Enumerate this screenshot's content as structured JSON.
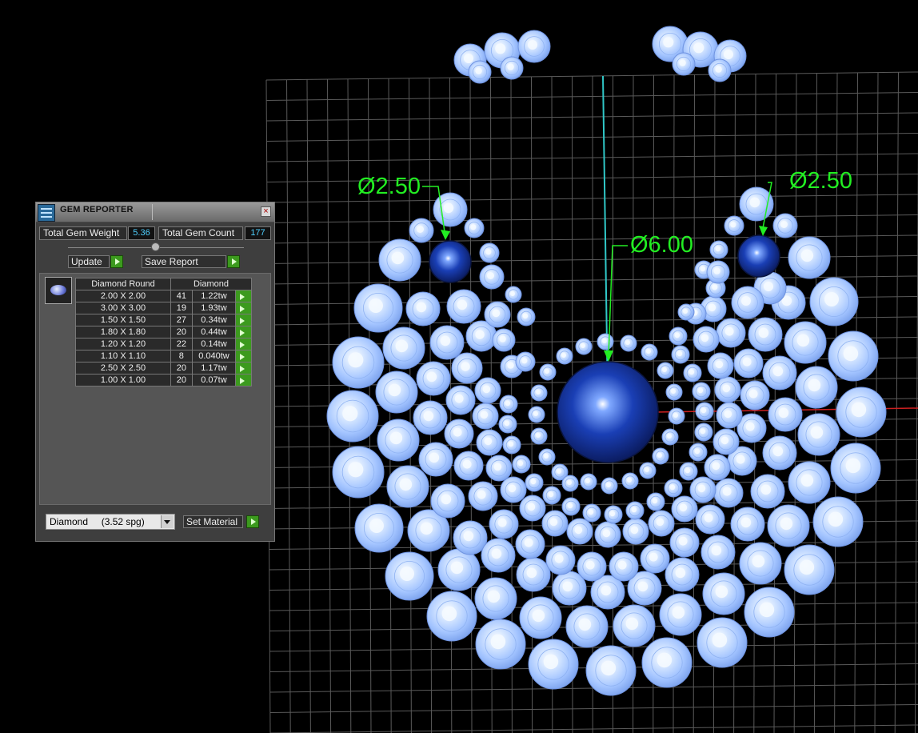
{
  "viewport": {
    "dim_labels": [
      "Ø2.50",
      "Ø6.00",
      "Ø2.50"
    ],
    "colors": {
      "background": "#000000",
      "grid": "#5a5a5a",
      "gem": "#a9c9ff",
      "center_stone": "#1a3fb5",
      "dimension": "#22ee22",
      "axis_y": "#30c8c8",
      "axis_x": "#cc2020"
    }
  },
  "panel": {
    "title": "GEM REPORTER",
    "close_icon": "close-icon",
    "total_weight_label": "Total Gem Weight",
    "total_weight_value": "5.36",
    "total_count_label": "Total Gem Count",
    "total_count_value": "177",
    "update_label": "Update",
    "save_report_label": "Save Report",
    "table": {
      "col1_header": "Diamond Round",
      "col2_header": "Diamond",
      "rows": [
        {
          "size": "2.00 X 2.00",
          "count": "41",
          "weight": "1.22tw"
        },
        {
          "size": "3.00 X 3.00",
          "count": "19",
          "weight": "1.93tw"
        },
        {
          "size": "1.50 X 1.50",
          "count": "27",
          "weight": "0.34tw"
        },
        {
          "size": "1.80 X 1.80",
          "count": "20",
          "weight": "0.44tw"
        },
        {
          "size": "1.20 X 1.20",
          "count": "22",
          "weight": "0.14tw"
        },
        {
          "size": "1.10 X 1.10",
          "count": "8",
          "weight": "0.040tw"
        },
        {
          "size": "2.50 X 2.50",
          "count": "20",
          "weight": "1.17tw"
        },
        {
          "size": "1.00 X 1.00",
          "count": "20",
          "weight": "0.07tw"
        }
      ]
    },
    "material_value": "Diamond     (3.52 spg)",
    "set_material_label": "Set Material"
  }
}
